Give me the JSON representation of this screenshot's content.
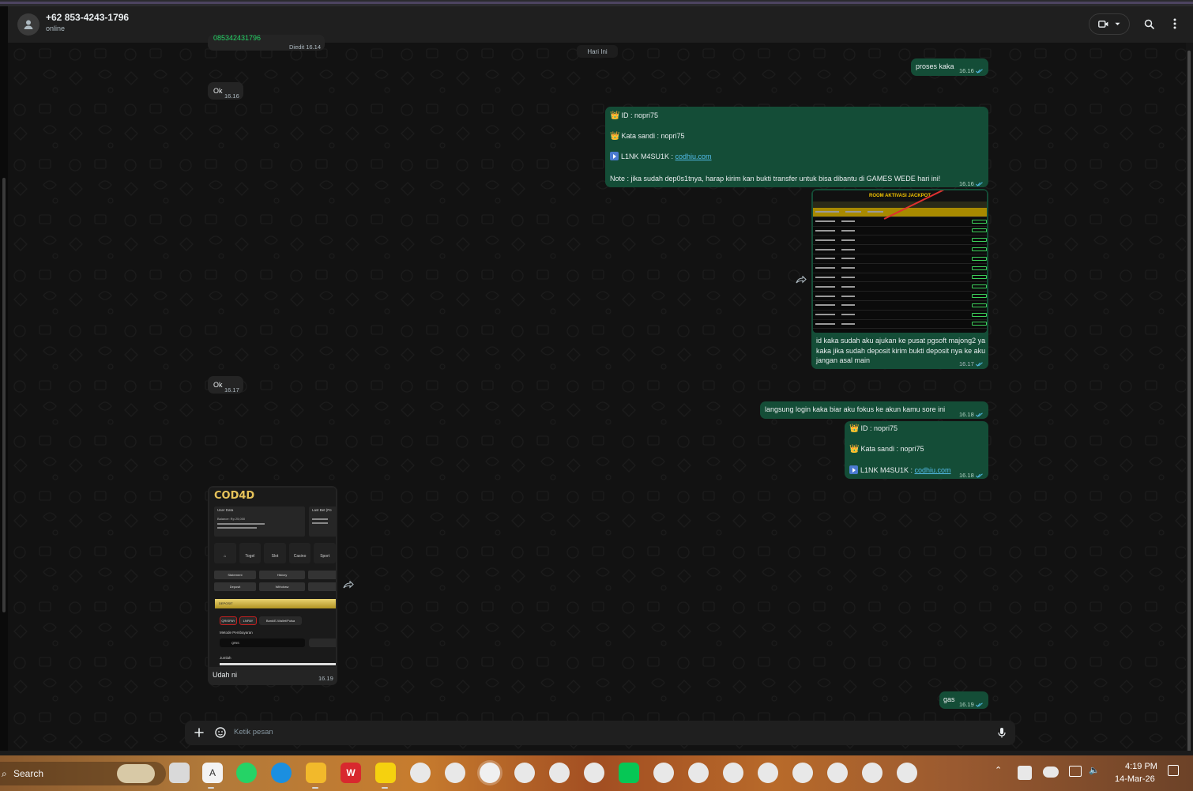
{
  "header": {
    "contact_name": "+62 853-4243-1796",
    "contact_status": "online"
  },
  "chat": {
    "partial_top_text": "085342431796",
    "partial_top_meta": "Diedit 16.14",
    "day_label": "Hari Ini",
    "messages": [
      {
        "dir": "out",
        "text": "proses kaka",
        "time": "16.16"
      },
      {
        "dir": "in",
        "text": "Ok",
        "time": "16.16"
      },
      {
        "dir": "out",
        "id_line": "ID :  nopri75",
        "password_line": "Kata sandi : nopri75",
        "link_label": "L1NK M4SU1K : ",
        "link": "codhiu.com",
        "note": "Note : jika sudah dep0s1tnya, harap kirim kan bukti transfer untuk bisa dibantu di GAMES WEDE hari ini!",
        "time": "16.16"
      },
      {
        "dir": "out",
        "image_title": "ROOM AKTIVASI JACKPOT",
        "caption": "id kaka sudah aku ajukan ke pusat pgsoft majong2 ya kaka jika sudah deposit kirim bukti deposit nya ke aku jangan asal main",
        "time": "16.17"
      },
      {
        "dir": "in",
        "text": "Ok",
        "time": "16.17"
      },
      {
        "dir": "out",
        "text": "langsung login kaka biar aku fokus ke akun kamu sore ini",
        "time": "16.18"
      },
      {
        "dir": "out",
        "id_line": "ID :  nopri75",
        "password_line": "Kata sandi : nopri75",
        "link_label": "L1NK M4SU1K : ",
        "link": "codhiu.com",
        "time": "16.18"
      },
      {
        "dir": "in",
        "image_brand": "COD4D",
        "caption": "Udah ni",
        "time": "16.19"
      },
      {
        "dir": "out",
        "text": "gas",
        "time": "16.19"
      }
    ]
  },
  "screenshot_labels": {
    "user_data": "User Data",
    "last_bet": "Last Bet (Pe",
    "balance": "Balance: Rp 25,000",
    "nav": [
      "Togel",
      "Slot",
      "Casino",
      "Sport"
    ],
    "statement": "Statement",
    "history": "History",
    "deposit": "Deposit",
    "withdraw": "Withdraw",
    "deposit_header": "DEPOSIT",
    "pay1": "QRISPAY",
    "pay2": "LNPAY",
    "pay3": "Bank/E-Wallet/Pulsa",
    "method": "Metode Pembayaran",
    "qris": "QRIS",
    "amount": "Jumlah"
  },
  "composer": {
    "placeholder": "Ketik pesan"
  },
  "taskbar": {
    "search": "Search",
    "time": "4:19 PM",
    "date": "14-Mar-26"
  },
  "colors": {
    "outgoing": "#144d37",
    "incoming": "#242424",
    "link": "#53bdeb"
  }
}
